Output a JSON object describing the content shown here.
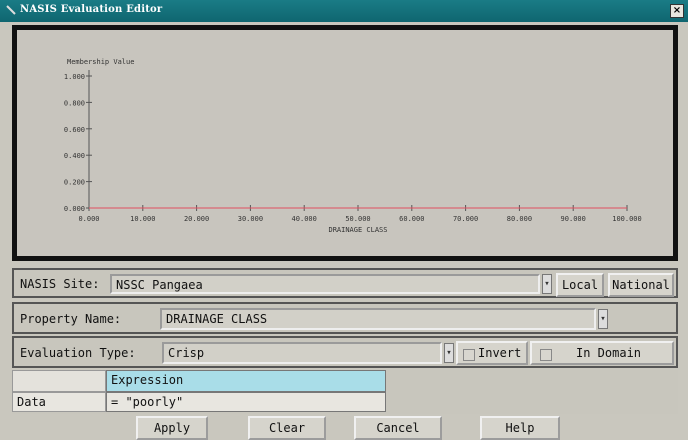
{
  "window": {
    "title": "NASIS Evaluation Editor",
    "close_label": "×"
  },
  "chart_data": {
    "type": "line",
    "ylabel": "Membership Value",
    "xlabel": "DRAINAGE CLASS",
    "xlim": [
      0,
      100
    ],
    "ylim": [
      0,
      1
    ],
    "xticks": [
      "0.000",
      "10.000",
      "20.000",
      "30.000",
      "40.000",
      "50.000",
      "60.000",
      "70.000",
      "80.000",
      "90.000",
      "100.000"
    ],
    "yticks": [
      "0.000",
      "0.200",
      "0.400",
      "0.600",
      "0.800",
      "1.000"
    ],
    "series": [
      {
        "x": [
          0,
          100
        ],
        "y": [
          0,
          0
        ],
        "color": "#e05060"
      }
    ]
  },
  "site": {
    "label": "NASIS Site:",
    "value": "NSSC Pangaea",
    "local_label": "Local",
    "national_label": "National"
  },
  "property": {
    "label": "Property Name:",
    "value": "DRAINAGE CLASS"
  },
  "evaluation": {
    "label": "Evaluation Type:",
    "value": "Crisp",
    "invert_label": "Invert",
    "in_domain_label": "In Domain"
  },
  "expression": {
    "header": "Expression",
    "row_label": "Data",
    "value": "= \"poorly\""
  },
  "buttons": {
    "apply": "Apply",
    "clear": "Clear",
    "cancel": "Cancel",
    "help": "Help"
  },
  "colors": {
    "titlebar": "#0f6670",
    "line": "#e05060",
    "header_cell": "#a9dde8"
  }
}
